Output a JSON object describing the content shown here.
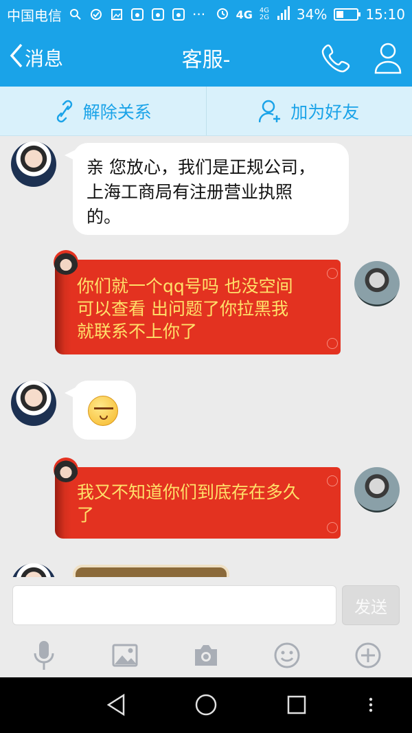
{
  "status_bar": {
    "carrier": "中国电信",
    "network": "4G",
    "network_small": "4G 2G",
    "battery": "34%",
    "battery_level": 0.34,
    "time": "15:10",
    "overflow": "···"
  },
  "header": {
    "back_label": "消息",
    "title": "客服-",
    "accent_color": "#1aa3e8"
  },
  "actions": {
    "unbind_label": "解除关系",
    "add_friend_label": "加为好友"
  },
  "messages": [
    {
      "from": "left",
      "type": "text",
      "lines": [
        "亲 您放心，我们是正规公司，",
        "上海工商局有注册营业执照",
        "的。"
      ]
    },
    {
      "from": "right",
      "type": "text",
      "lines": [
        "你们就一个qq号吗   也没空间",
        "可以查看    出问题了你拉黑我",
        "就联系不上你了"
      ]
    },
    {
      "from": "left",
      "type": "emoji",
      "emoji": "annoyed-face"
    },
    {
      "from": "right",
      "type": "text",
      "lines": [
        "我又不知道你们到底存在多久",
        "了"
      ]
    },
    {
      "from": "left",
      "type": "image"
    }
  ],
  "composer": {
    "input_value": "",
    "input_placeholder": "",
    "send_label": "发送"
  },
  "toolbar": [
    "microphone-icon",
    "image-icon",
    "camera-icon",
    "emoticon-icon",
    "plus-icon"
  ],
  "colors": {
    "bubble_red": "#e33220",
    "bubble_red_text": "#ffe16a",
    "bubble_white": "#ffffff"
  }
}
